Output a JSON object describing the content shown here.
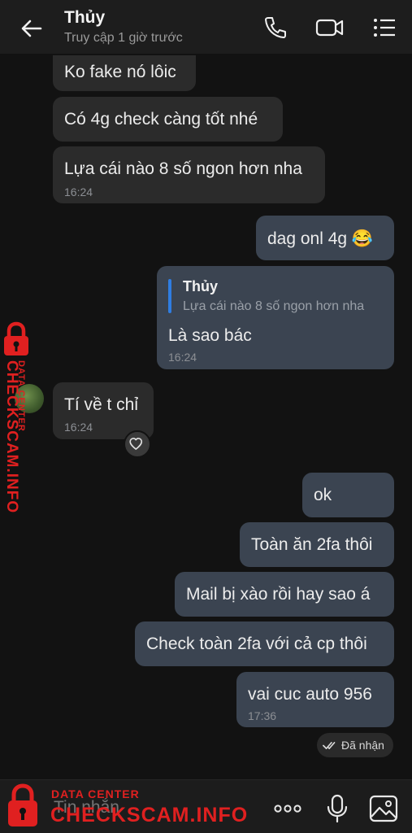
{
  "header": {
    "title": "Thủy",
    "subtitle": "Truy cập 1 giờ trước"
  },
  "messages": [
    {
      "text": "Ko fake nó lôic"
    },
    {
      "text": "Có 4g check càng tốt nhé"
    },
    {
      "text": "Lựa cái nào 8 số ngon hơn nha",
      "time": "16:24"
    },
    {
      "text": "dag onl 4g 😂"
    },
    {
      "quote_name": "Thủy",
      "quote_text": "Lựa cái nào 8 số ngon hơn nha",
      "text": "Là sao bác",
      "time": "16:24"
    },
    {
      "text": "Tí về t chỉ",
      "time": "16:24"
    },
    {
      "text": "ok"
    },
    {
      "text": "Toàn ăn 2fa thôi"
    },
    {
      "text": "Mail bị xào rồi hay sao á"
    },
    {
      "text": "Check toàn 2fa với cả cp thôi"
    },
    {
      "text": "vai cuc auto 956",
      "time": "17:36"
    }
  ],
  "status": {
    "label": "Đã nhận"
  },
  "footer": {
    "placeholder": "Tin nhắn"
  },
  "watermark": {
    "line1": "DATA CENTER",
    "line2": "CHECKSCAM.INFO"
  },
  "icons": {
    "back": "arrow-left-icon",
    "call": "phone-icon",
    "video": "video-camera-icon",
    "menu": "list-menu-icon",
    "react": "heart-icon",
    "more": "more-dots-icon",
    "mic": "microphone-icon",
    "image": "image-icon",
    "lock": "lock-icon"
  }
}
